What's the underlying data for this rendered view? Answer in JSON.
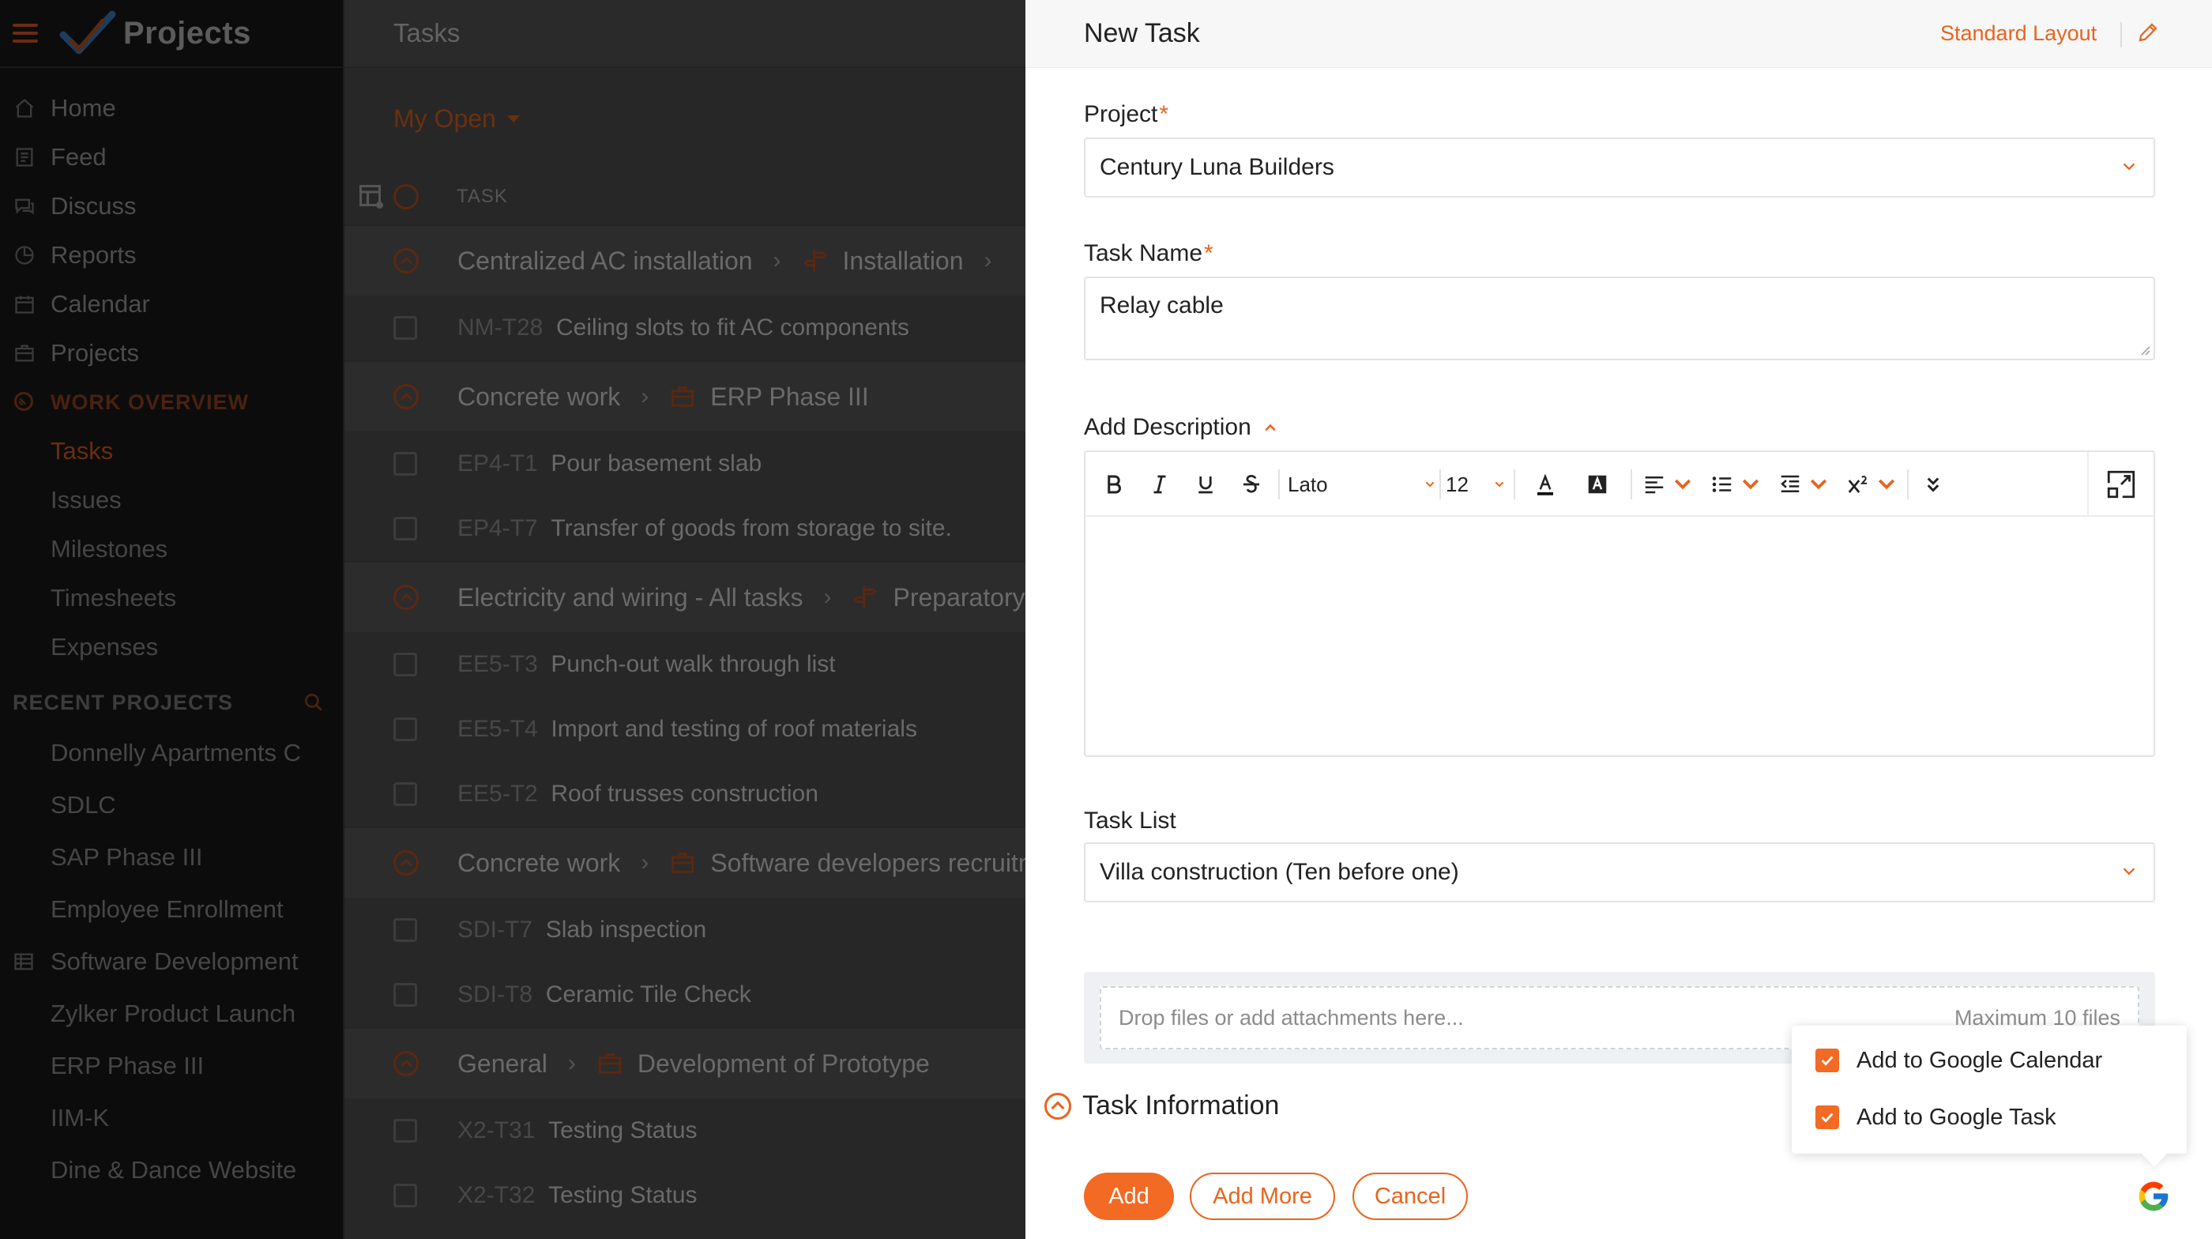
{
  "app": {
    "title": "Projects"
  },
  "sidebar": {
    "nav": [
      "Home",
      "Feed",
      "Discuss",
      "Reports",
      "Calendar",
      "Projects"
    ],
    "work_overview": {
      "title": "WORK OVERVIEW",
      "items": [
        "Tasks",
        "Issues",
        "Milestones",
        "Timesheets",
        "Expenses"
      ]
    },
    "recent": {
      "title": "RECENT PROJECTS",
      "items": [
        "Donnelly Apartments C",
        "SDLC",
        "SAP Phase III",
        "Employee Enrollment",
        "Software Development",
        "Zylker Product Launch",
        "ERP Phase III",
        "IIM-K",
        "Dine & Dance Website"
      ]
    }
  },
  "main": {
    "header": "Tasks",
    "filter": "My Open",
    "column_task": "TASK",
    "groups": [
      {
        "list": "Centralized AC installation",
        "project": "Installation",
        "tasks": [
          {
            "id": "NM-T28",
            "name": "Ceiling slots to fit AC components"
          }
        ]
      },
      {
        "list": "Concrete work",
        "project": "ERP Phase III",
        "tasks": [
          {
            "id": "EP4-T1",
            "name": "Pour basement slab"
          },
          {
            "id": "EP4-T7",
            "name": "Transfer of goods from storage to site."
          }
        ]
      },
      {
        "list": "Electricity and wiring - All tasks",
        "project": "Preparatory",
        "tasks": [
          {
            "id": "EE5-T3",
            "name": "Punch-out walk through list"
          },
          {
            "id": "EE5-T4",
            "name": "Import and testing of roof materials"
          },
          {
            "id": "EE5-T2",
            "name": "Roof trusses construction"
          }
        ]
      },
      {
        "list": "Concrete work",
        "project": "Software developers recruitment",
        "tasks": [
          {
            "id": "SDI-T7",
            "name": "Slab inspection"
          },
          {
            "id": "SDI-T8",
            "name": "Ceramic Tile Check"
          }
        ]
      },
      {
        "list": "General",
        "project": "Development of Prototype",
        "tasks": [
          {
            "id": "X2-T31",
            "name": "Testing Status"
          },
          {
            "id": "X2-T32",
            "name": "Testing Status"
          }
        ]
      }
    ]
  },
  "panel": {
    "title": "New Task",
    "layout_link": "Standard Layout",
    "project": {
      "label": "Project",
      "value": "Century Luna Builders"
    },
    "task_name": {
      "label": "Task Name",
      "value": "Relay cable"
    },
    "description": {
      "label": "Add Description"
    },
    "editor": {
      "font": "Lato",
      "size": "12"
    },
    "task_list": {
      "label": "Task List",
      "value": "Villa construction (Ten before one)"
    },
    "attachments": {
      "placeholder": "Drop files or add attachments here...",
      "max": "Maximum 10 files"
    },
    "task_info": "Task Information",
    "buttons": {
      "add": "Add",
      "add_more": "Add More",
      "cancel": "Cancel"
    },
    "google_popup": {
      "calendar": "Add to Google Calendar",
      "task": "Add to Google Task"
    }
  },
  "colors": {
    "accent": "#f26a24",
    "text": "#222222",
    "overlay": "#272727"
  }
}
